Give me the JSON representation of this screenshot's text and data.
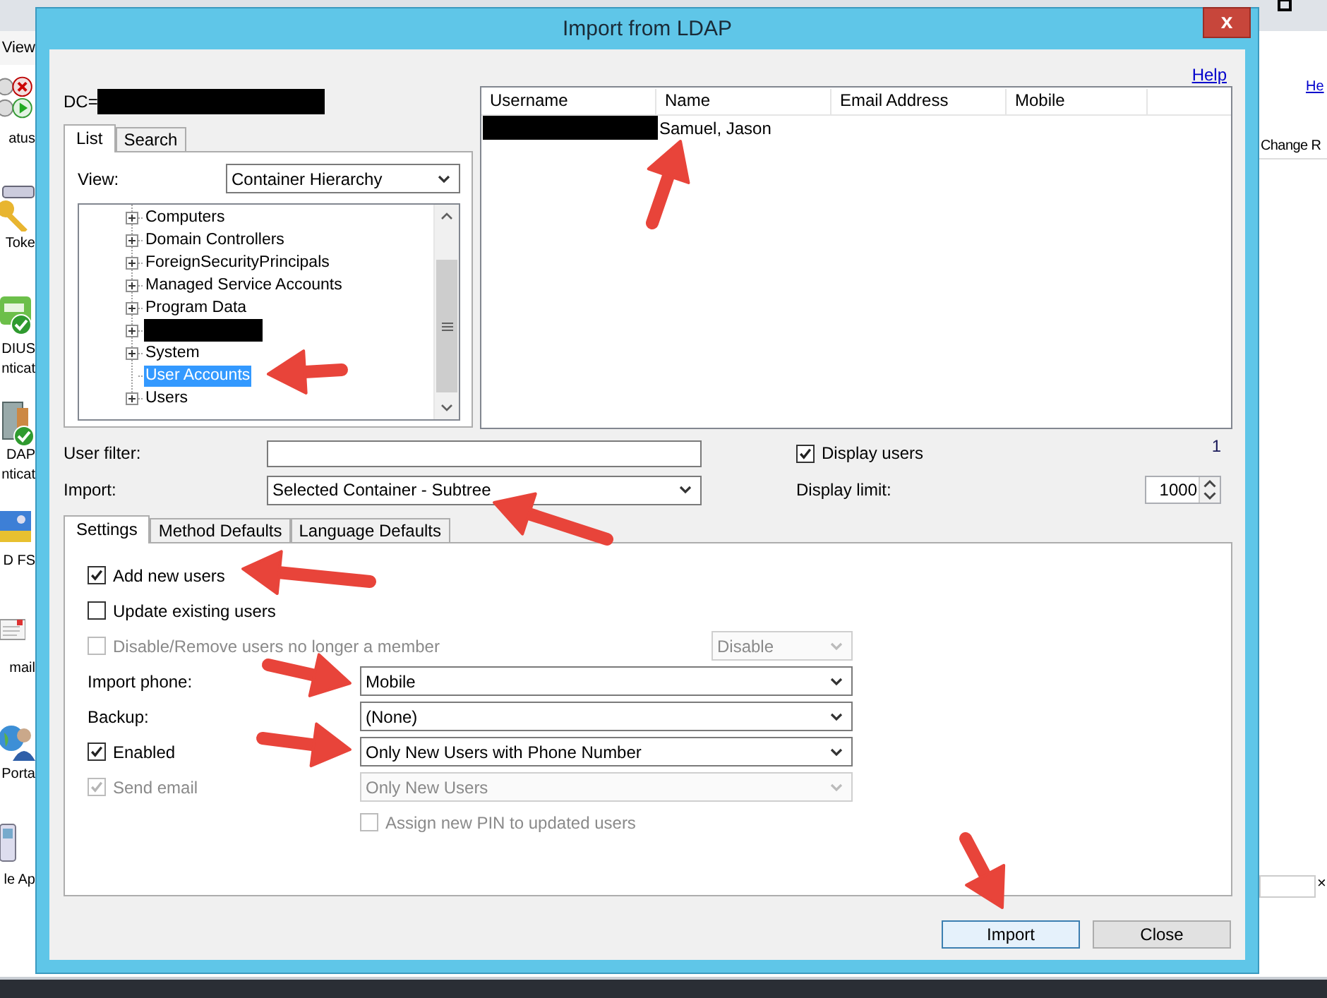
{
  "background_app": {
    "menu_item": "View",
    "sidebar_labels": [
      "atus",
      "Toke",
      "DIUS",
      "nticat",
      "DAP",
      "nticat",
      "D FS",
      "mail",
      "Porta",
      "le Ap"
    ],
    "right_link": "He",
    "right_column": "Change R",
    "field_clear": "×"
  },
  "dialog": {
    "title": "Import from LDAP",
    "close": "x",
    "help": "Help",
    "dc_label": "DC=",
    "dc_redacted": true,
    "left_tabs": [
      {
        "label": "List",
        "selected": true
      },
      {
        "label": "Search",
        "selected": false
      }
    ],
    "view": {
      "label": "View:",
      "value": "Container Hierarchy"
    },
    "tree": [
      {
        "label": "Computers",
        "expandable": true,
        "selected": false
      },
      {
        "label": "Domain Controllers",
        "expandable": true,
        "selected": false
      },
      {
        "label": "ForeignSecurityPrincipals",
        "expandable": true,
        "selected": false
      },
      {
        "label": "Managed Service Accounts",
        "expandable": true,
        "selected": false
      },
      {
        "label": "Program Data",
        "expandable": true,
        "selected": false
      },
      {
        "redacted": true,
        "expandable": true,
        "selected": false
      },
      {
        "label": "System",
        "expandable": true,
        "selected": false
      },
      {
        "label": "User Accounts",
        "expandable": false,
        "selected": true
      },
      {
        "label": "Users",
        "expandable": true,
        "selected": false
      }
    ],
    "users_table": {
      "columns": [
        "Username",
        "Name",
        "Email Address",
        "Mobile"
      ],
      "rows": [
        {
          "username_redacted": true,
          "name": "Samuel, Jason"
        }
      ],
      "count": "1"
    },
    "user_filter": {
      "label": "User filter:"
    },
    "import": {
      "label": "Import:",
      "value": "Selected Container - Subtree"
    },
    "display_users": {
      "label": "Display users",
      "checked": true
    },
    "display_limit": {
      "label": "Display limit:",
      "value": "1000"
    },
    "settings_tabs": [
      {
        "label": "Settings",
        "selected": true
      },
      {
        "label": "Method Defaults",
        "selected": false
      },
      {
        "label": "Language Defaults",
        "selected": false
      }
    ],
    "settings": [
      {
        "kind": "checkbox",
        "label": "Add new users",
        "checked": true,
        "disabled": false
      },
      {
        "kind": "checkbox",
        "label": "Update existing users",
        "checked": false,
        "disabled": false
      },
      {
        "kind": "checkbox_option",
        "label": "Disable/Remove users no longer a member",
        "checked": false,
        "disabled": true,
        "value": "Disable"
      },
      {
        "kind": "field",
        "label": "Import phone:",
        "value": "Mobile",
        "disabled": false
      },
      {
        "kind": "field",
        "label": "Backup:",
        "value": "(None)",
        "disabled": false
      },
      {
        "kind": "checkbox_field",
        "label": "Enabled",
        "checked": true,
        "disabled": false,
        "value": "Only New Users with Phone Number"
      },
      {
        "kind": "checkbox_field",
        "label": "Send email",
        "checked": true,
        "disabled": true,
        "value": "Only New Users"
      },
      {
        "kind": "sub_checkbox",
        "label": "Assign new PIN to updated users",
        "checked": false,
        "disabled": true
      }
    ],
    "buttons": [
      {
        "label": "Import",
        "default": true
      },
      {
        "label": "Close",
        "default": false
      }
    ]
  }
}
